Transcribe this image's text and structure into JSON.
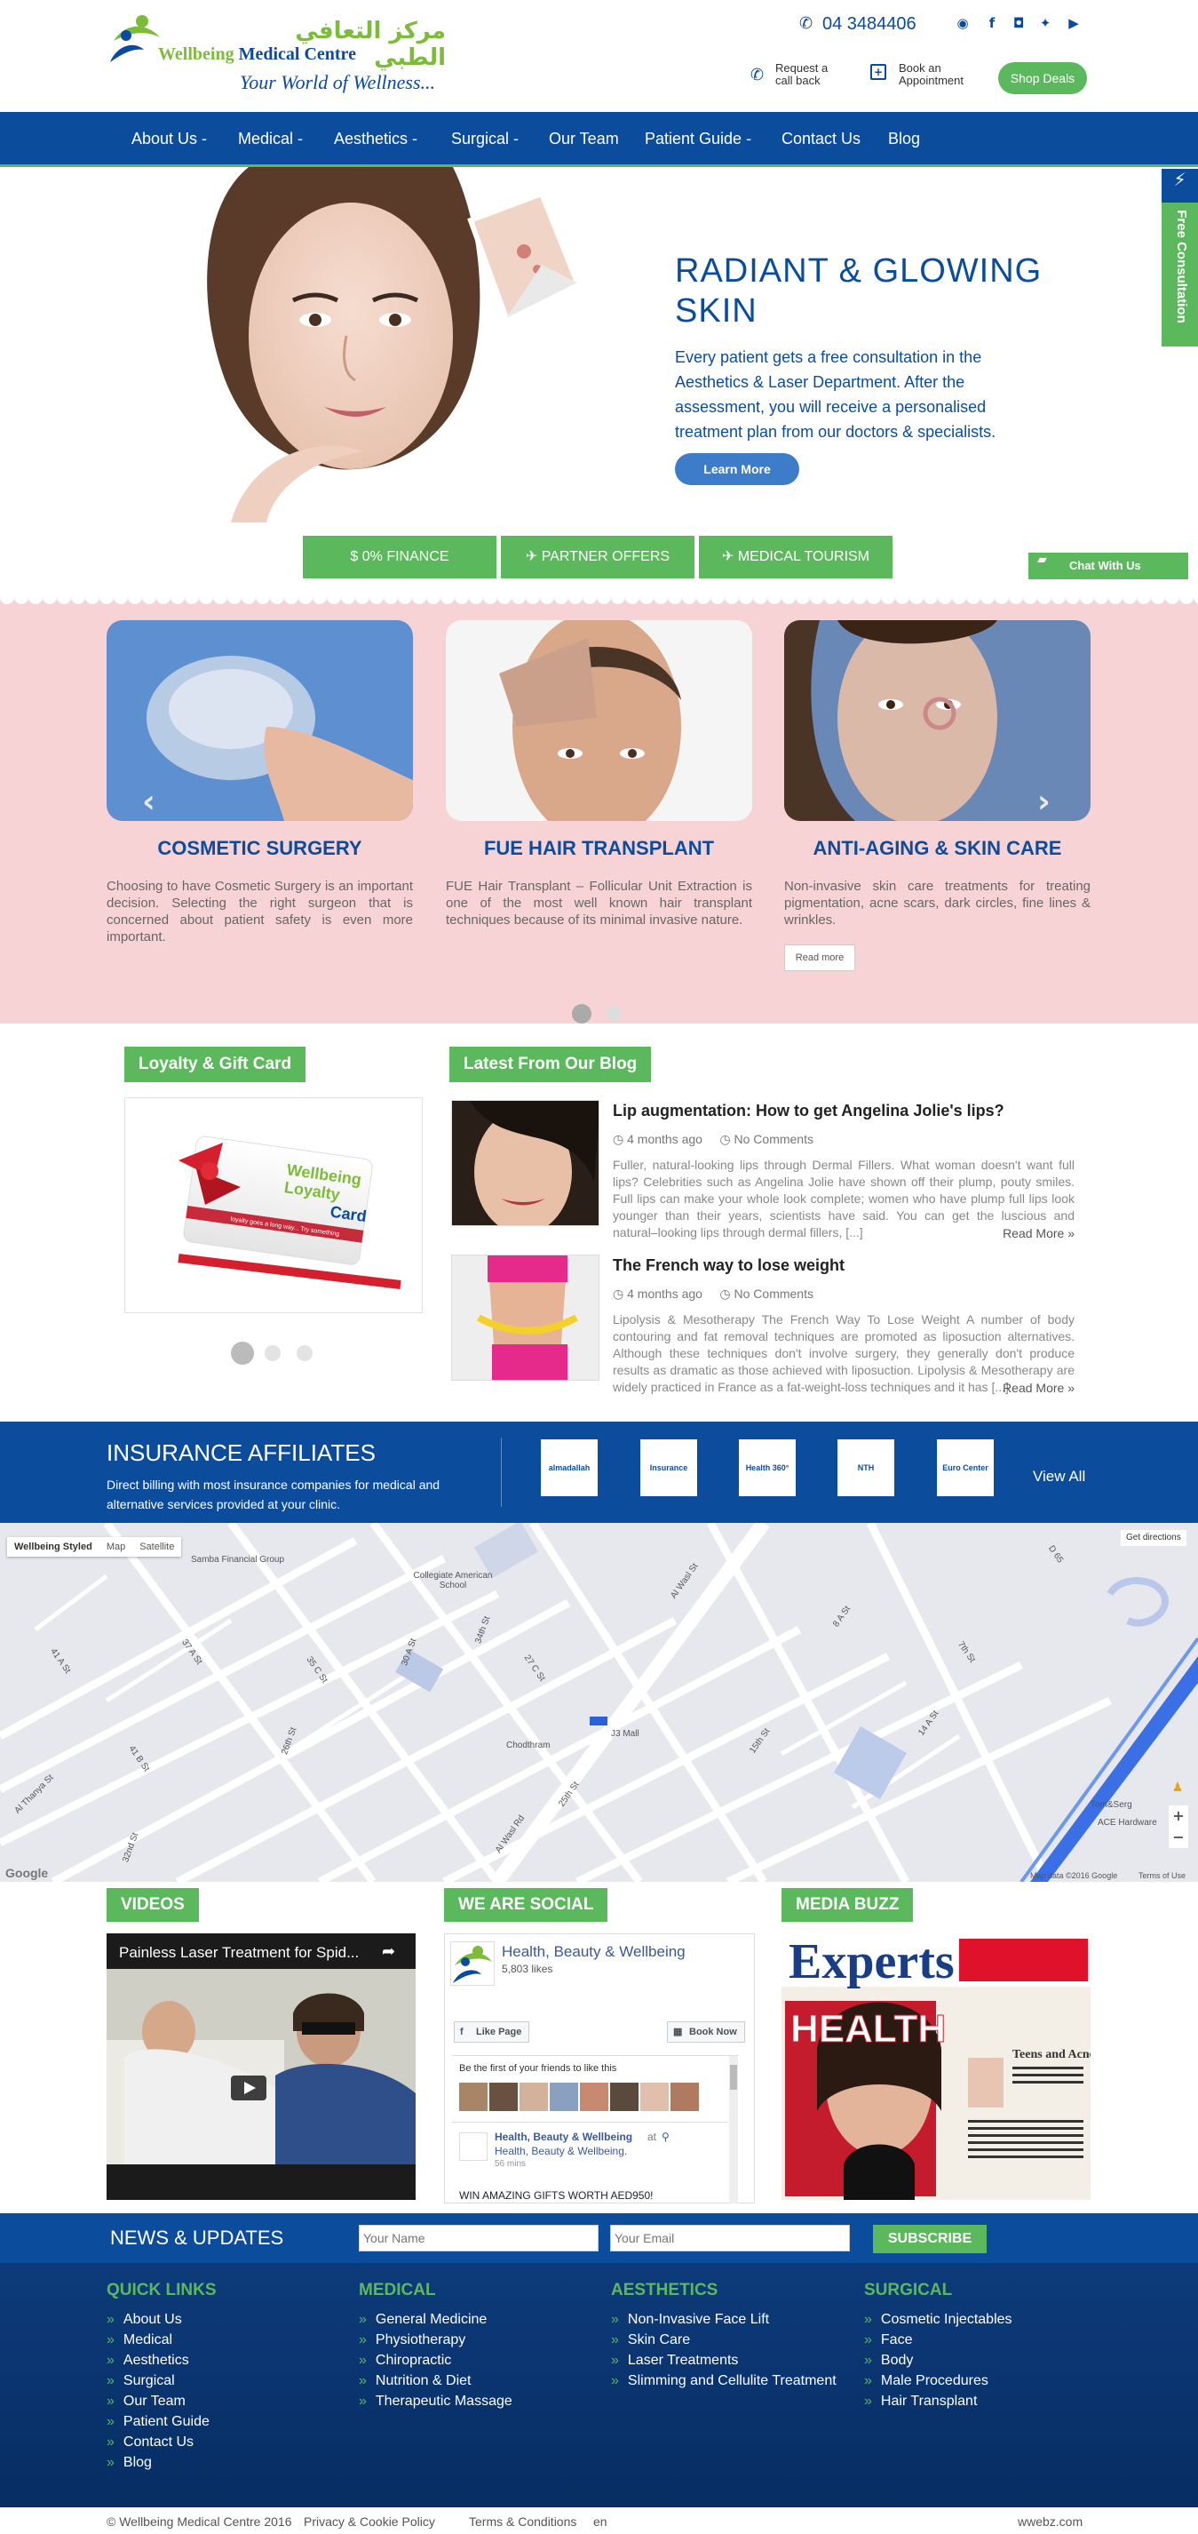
{
  "header": {
    "logo_arabic": "مركز التعافي الطبي",
    "logo_name_part1": "Wellbeing",
    "logo_name_part2": "Medical Centre",
    "logo_tagline": "Your World of Wellness...",
    "phone": "04 3484406",
    "callback_label_line1": "Request a",
    "callback_label_line2": "call back",
    "appointment_label_line1": "Book an",
    "appointment_label_line2": "Appointment",
    "shop_button": "Shop Deals",
    "social_icons": [
      "whatsapp-icon",
      "facebook-icon",
      "instagram-icon",
      "twitter-icon",
      "youtube-icon"
    ]
  },
  "nav": {
    "items": [
      "About Us -",
      "Medical -",
      "Aesthetics -",
      "Surgical -",
      "Our Team",
      "Patient Guide -",
      "Contact Us",
      "Blog"
    ]
  },
  "hero": {
    "title_line1": "RADIANT & GLOWING",
    "title_line2": "SKIN",
    "text": "Every patient gets a free consultation in the Aesthetics & Laser Department. After the assessment, you will receive a personalised treatment plan from our doctors & specialists.",
    "button": "Learn More",
    "side_tab": "Free Consultation"
  },
  "promo_buttons": [
    "$ 0% FINANCE",
    "✈ PARTNER OFFERS",
    "✈ MEDICAL TOURISM"
  ],
  "chat_label": "Chat With Us",
  "services": [
    {
      "title": "COSMETIC SURGERY",
      "text": "Choosing to have Cosmetic Surgery is an important decision. Selecting the right surgeon that is concerned about patient safety is even more important."
    },
    {
      "title": "FUE HAIR TRANSPLANT",
      "text": "FUE Hair Transplant – Follicular Unit Extraction is one of the most well known hair transplant techniques because of its minimal invasive nature."
    },
    {
      "title": "ANTI-AGING & SKIN CARE",
      "text": "Non-invasive skin care treatments for treating pigmentation, acne scars, dark circles, fine lines & wrinkles.",
      "button": "Read more"
    }
  ],
  "loyalty": {
    "heading": "Loyalty & Gift Card",
    "card_title_line1": "Wellbeing",
    "card_title_line2": "Loyalty",
    "card_title_line3": "Card",
    "card_tagline": "loyalty goes a long way... Try something"
  },
  "blog": {
    "heading": "Latest From Our Blog",
    "posts": [
      {
        "title": "Lip augmentation: How to get Angelina Jolie's lips?",
        "date": "4 months ago",
        "comments": "No Comments",
        "excerpt": "Fuller, natural-looking lips through Dermal Fillers. What woman doesn't want full lips? Celebrities such as Angelina Jolie have shown off their plump, pouty smiles. Full lips can make your whole look complete; women who have plump full lips look younger than their years, scientists have said. You can get the luscious and natural–looking lips through dermal fillers, [...]",
        "more": "Read More »"
      },
      {
        "title": "The French way to lose weight",
        "date": "4 months ago",
        "comments": "No Comments",
        "excerpt": "Lipolysis & Mesotherapy The French Way To Lose Weight A number of body contouring and fat removal techniques are promoted as liposuction alternatives. Although these techniques don't involve surgery, they generally don't produce results as dramatic as those achieved with liposuction. Lipolysis & Mesotherapy are widely practiced in France as a fat-weight-loss techniques and it has [...]",
        "more": "Read More »"
      }
    ]
  },
  "insurance": {
    "heading": "INSURANCE AFFILIATES",
    "text": "Direct billing with most insurance companies for medical and alternative services provided at your clinic.",
    "logos": [
      "almadallah",
      "Insurance",
      "Health 360°",
      "NTH Worldwide",
      "Euro Center"
    ],
    "view_all": "View All"
  },
  "map": {
    "tabs": [
      "Wellbeing Styled",
      "Map",
      "Satellite"
    ],
    "get_directions": "Get directions",
    "labels": [
      "Samba Financial Group",
      "Collegiate American School",
      "Al Wasl St",
      "27 C St",
      "J3 Mall",
      "Chodthram",
      "15th St",
      "14 A St",
      "8 A St",
      "7th St",
      "D 65",
      "37 A St",
      "35 C St",
      "30 A St",
      "34th St",
      "41 A St",
      "41 B St",
      "26th St",
      "32nd St",
      "Al Wasl Rd",
      "25th St",
      "Tom&Serg",
      "ACE Hardware",
      "Al Thanya St"
    ],
    "footer": "Map data ©2016 Google",
    "terms": "Terms of Use",
    "brand": "Google"
  },
  "videos": {
    "heading": "VIDEOS",
    "video_title": "Painless Laser Treatment for Spid..."
  },
  "social": {
    "heading": "WE ARE SOCIAL",
    "page_name": "Health, Beauty & Wellbeing",
    "likes": "5,803 likes",
    "like_button": "Like Page",
    "book_button": "Book Now",
    "friends_text": "Be the first of your friends to like this",
    "post_author": "Health, Beauty & Wellbeing",
    "post_at": "at",
    "post_location": "Health, Beauty & Wellbeing.",
    "post_time": "56 mins",
    "post_text": "WIN AMAZING GIFTS WORTH AED950!"
  },
  "media": {
    "heading": "MEDIA BUZZ",
    "mag_title": "Experts",
    "mag_health": "HEALTH",
    "mag_side": "Teens and Acne"
  },
  "newsletter": {
    "heading": "NEWS & UPDATES",
    "name_placeholder": "Your Name",
    "email_placeholder": "Your Email",
    "button": "SUBSCRIBE"
  },
  "footer": {
    "quick_links": {
      "heading": "QUICK LINKS",
      "items": [
        "About Us",
        "Medical",
        "Aesthetics",
        "Surgical",
        "Our Team",
        "Patient Guide",
        "Contact Us",
        "Blog"
      ]
    },
    "medical": {
      "heading": "MEDICAL",
      "items": [
        "General Medicine",
        "Physiotherapy",
        "Chiropractic",
        "Nutrition & Diet",
        "Therapeutic Massage"
      ]
    },
    "aesthetics": {
      "heading": "AESTHETICS",
      "items": [
        "Non-Invasive Face Lift",
        "Skin Care",
        "Laser Treatments",
        "Slimming and Cellulite Treatment"
      ]
    },
    "surgical": {
      "heading": "SURGICAL",
      "items": [
        "Cosmetic Injectables",
        "Face",
        "Body",
        "Male Procedures",
        "Hair Transplant"
      ]
    }
  },
  "copyright": {
    "text": "© Wellbeing Medical Centre 2016",
    "privacy": "Privacy & Cookie Policy",
    "terms": "Terms & Conditions",
    "lang": "en",
    "credit": "wwebz.com"
  }
}
